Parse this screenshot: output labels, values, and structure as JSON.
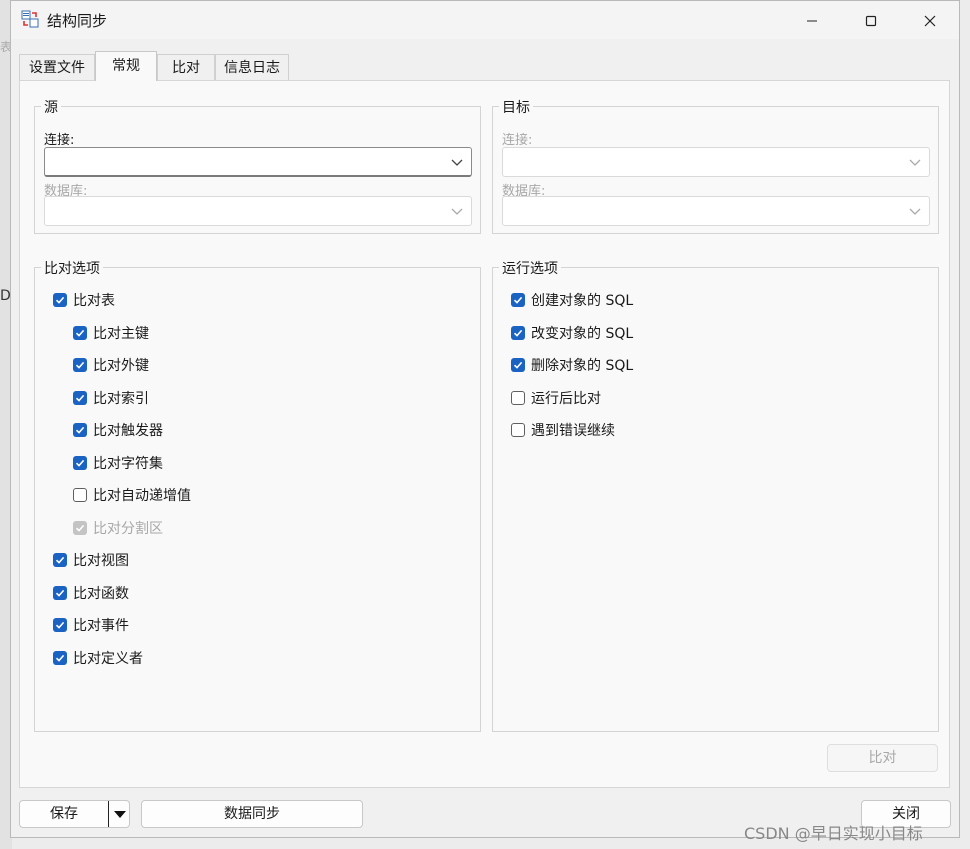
{
  "window": {
    "title": "结构同步"
  },
  "tabs": [
    "设置文件",
    "常规",
    "比对",
    "信息日志"
  ],
  "source": {
    "title": "源",
    "connection_label": "连接:",
    "database_label": "数据库:"
  },
  "target": {
    "title": "目标",
    "connection_label": "连接:",
    "database_label": "数据库:"
  },
  "compare_options": {
    "title": "比对选项",
    "items": [
      {
        "label": "比对表",
        "checked": true,
        "disabled": false
      },
      {
        "label": "比对主键",
        "checked": true,
        "disabled": false
      },
      {
        "label": "比对外键",
        "checked": true,
        "disabled": false
      },
      {
        "label": "比对索引",
        "checked": true,
        "disabled": false
      },
      {
        "label": "比对触发器",
        "checked": true,
        "disabled": false
      },
      {
        "label": "比对字符集",
        "checked": true,
        "disabled": false
      },
      {
        "label": "比对自动递增值",
        "checked": false,
        "disabled": false
      },
      {
        "label": "比对分割区",
        "checked": true,
        "disabled": true
      },
      {
        "label": "比对视图",
        "checked": true,
        "disabled": false
      },
      {
        "label": "比对函数",
        "checked": true,
        "disabled": false
      },
      {
        "label": "比对事件",
        "checked": true,
        "disabled": false
      },
      {
        "label": "比对定义者",
        "checked": true,
        "disabled": false
      }
    ]
  },
  "run_options": {
    "title": "运行选项",
    "items": [
      {
        "label": "创建对象的 SQL",
        "checked": true
      },
      {
        "label": "改变对象的 SQL",
        "checked": true
      },
      {
        "label": "删除对象的 SQL",
        "checked": true
      },
      {
        "label": "运行后比对",
        "checked": false
      },
      {
        "label": "遇到错误继续",
        "checked": false
      }
    ]
  },
  "buttons": {
    "compare": "比对",
    "save": "保存",
    "sync": "数据同步",
    "close": "关闭"
  },
  "background": {
    "glyph_top": "表",
    "glyph_side": "D"
  },
  "watermark": "CSDN @早日实现小目标",
  "colors": {
    "checkbox_on": "#1a63c2",
    "disabled_text": "#a8a8a8"
  }
}
